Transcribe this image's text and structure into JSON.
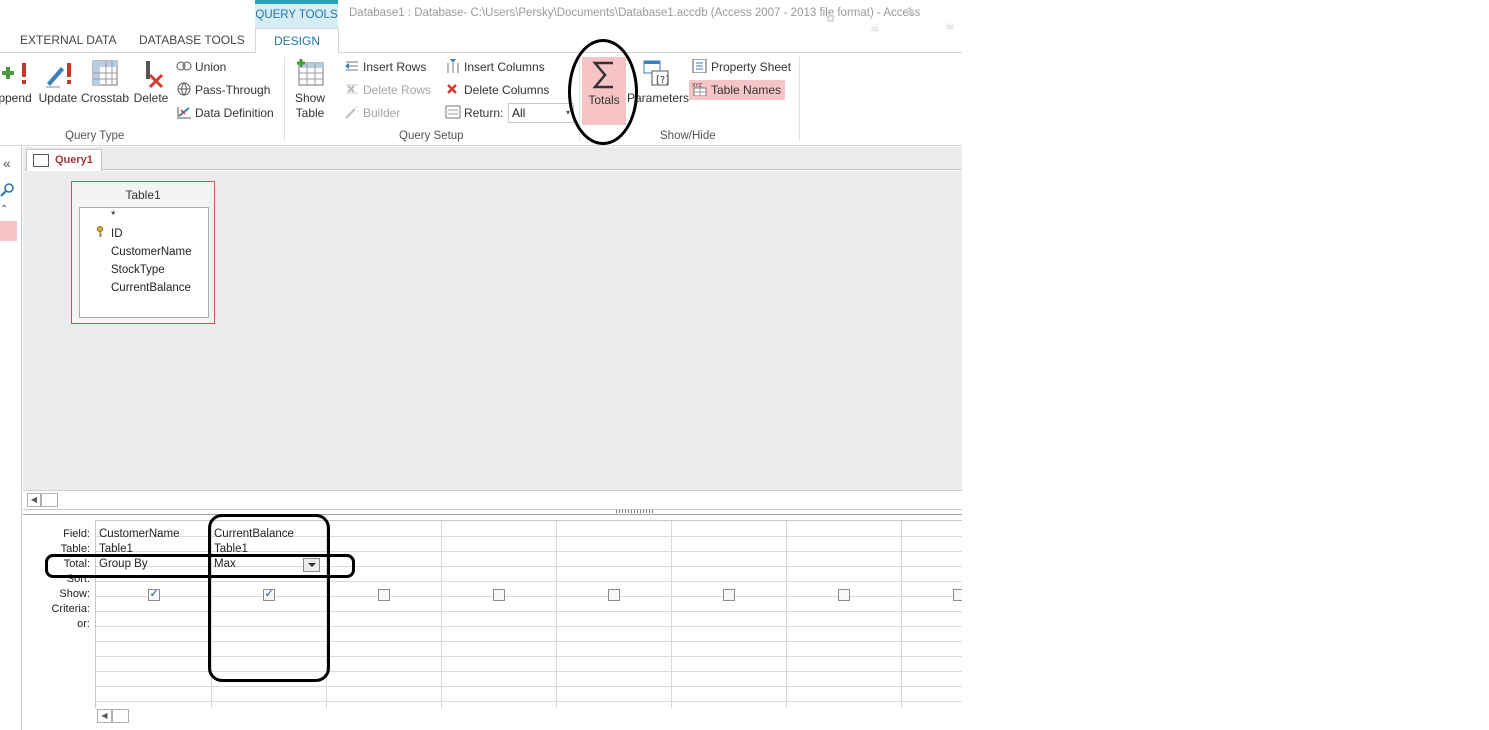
{
  "titlebar": {
    "context_tab": "QUERY TOOLS",
    "window_title": "Database1 : Database- C:\\Users\\Persky\\Documents\\Database1.accdb (Access 2007 - 2013 file format) - Access"
  },
  "ribbon_tabs": [
    "EXTERNAL DATA",
    "DATABASE TOOLS",
    "DESIGN"
  ],
  "ribbon": {
    "query_type": {
      "label": "Query Type",
      "append": "ppend",
      "update": "Update",
      "crosstab": "Crosstab",
      "delete": "Delete",
      "union": "Union",
      "pass_through": "Pass-Through",
      "data_definition": "Data Definition"
    },
    "query_setup": {
      "label": "Query Setup",
      "show_table_line1": "Show",
      "show_table_line2": "Table",
      "insert_rows": "Insert Rows",
      "delete_rows": "Delete Rows",
      "builder": "Builder",
      "insert_columns": "Insert Columns",
      "delete_columns": "Delete Columns",
      "return_label": "Return:",
      "return_value": "All"
    },
    "show_hide": {
      "label": "Show/Hide",
      "totals": "Totals",
      "parameters": "Parameters",
      "property_sheet": "Property Sheet",
      "table_names": "Table Names"
    }
  },
  "document_tab": "Query1",
  "table": {
    "name": "Table1",
    "fields": [
      "*",
      "ID",
      "CustomerName",
      "StockType",
      "CurrentBalance"
    ]
  },
  "grid": {
    "row_labels": [
      "Field:",
      "Table:",
      "Total:",
      "Sort:",
      "Show:",
      "Criteria:",
      "or:"
    ],
    "columns": [
      {
        "field": "CustomerName",
        "table": "Table1",
        "total": "Group By",
        "show": true
      },
      {
        "field": "CurrentBalance",
        "table": "Table1",
        "total": "Max",
        "show": true
      },
      {
        "field": "",
        "table": "",
        "total": "",
        "show": false
      },
      {
        "field": "",
        "table": "",
        "total": "",
        "show": false
      },
      {
        "field": "",
        "table": "",
        "total": "",
        "show": false
      },
      {
        "field": "",
        "table": "",
        "total": "",
        "show": false
      },
      {
        "field": "",
        "table": "",
        "total": "",
        "show": false
      },
      {
        "field": "",
        "table": "",
        "total": "",
        "show": false
      }
    ]
  },
  "colors": {
    "accent": "#2474a7",
    "highlight": "#f6c4c6",
    "table_border": "#c4585c",
    "design_bg": "#ececef"
  }
}
